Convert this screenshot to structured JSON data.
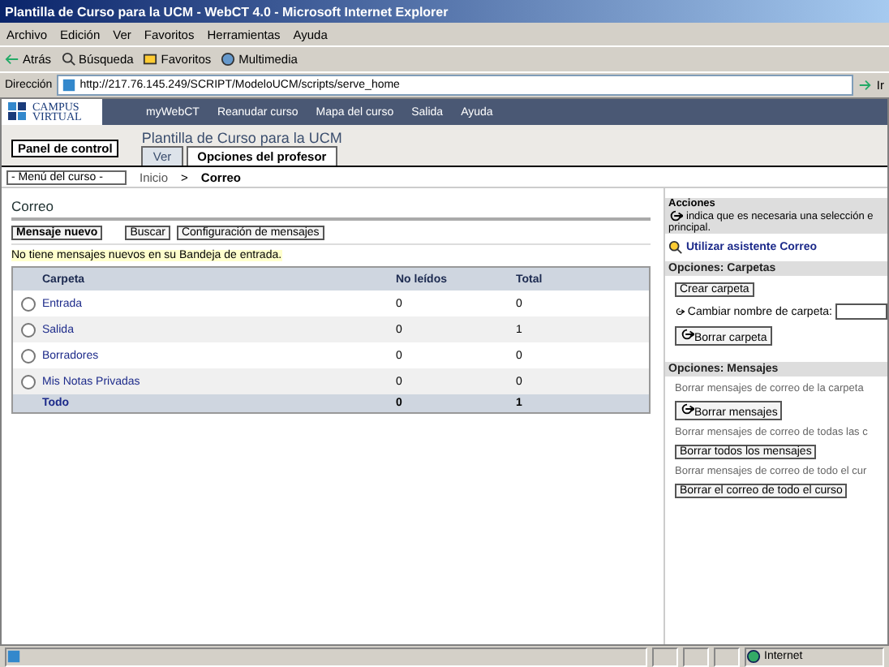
{
  "window": {
    "title": "Plantilla de Curso para la UCM - WebCT 4.0 - Microsoft Internet Explorer"
  },
  "menu": [
    "Archivo",
    "Edición",
    "Ver",
    "Favoritos",
    "Herramientas",
    "Ayuda"
  ],
  "toolbar": [
    {
      "kind": "back",
      "label": "Atrás"
    },
    {
      "kind": "search",
      "label": "Búsqueda"
    },
    {
      "kind": "favorites",
      "label": "Favoritos"
    },
    {
      "kind": "media",
      "label": "Multimedia"
    }
  ],
  "address": {
    "label": "Dirección",
    "url": "http://217.76.145.249/SCRIPT/ModeloUCM/scripts/serve_home",
    "go": "Ir"
  },
  "site": {
    "logo": [
      "CAMPUS",
      "VIRTUAL"
    ],
    "nav": [
      "myWebCT",
      "Reanudar curso",
      "Mapa del curso",
      "Salida",
      "Ayuda"
    ]
  },
  "course": {
    "control_panel": "Panel de control",
    "title": "Plantilla de Curso para la UCM",
    "tabs": [
      {
        "label": "Ver",
        "selected": false
      },
      {
        "label": "Opciones del profesor",
        "selected": true
      }
    ],
    "menu_select": "- Menú del curso -",
    "breadcrumb_separator": ">",
    "breadcrumb": [
      {
        "label": "Inicio",
        "current": false
      },
      {
        "label": "Correo",
        "current": true
      }
    ]
  },
  "mail": {
    "title": "Correo",
    "buttons": [
      "Mensaje nuevo",
      "Buscar",
      "Configuración de mensajes"
    ],
    "notice": "No tiene mensajes nuevos en su Bandeja de entrada.",
    "table": {
      "columns": [
        "Carpeta",
        "No leídos",
        "Total"
      ],
      "rows": [
        {
          "folder": "Entrada",
          "unread": "0",
          "total": "0",
          "selected": false
        },
        {
          "folder": "Salida",
          "unread": "0",
          "total": "1",
          "selected": false
        },
        {
          "folder": "Borradores",
          "unread": "0",
          "total": "0",
          "selected": false
        },
        {
          "folder": "Mis Notas Privadas",
          "unread": "0",
          "total": "0",
          "selected": false
        }
      ],
      "total": {
        "label": "Todo",
        "unread": "0",
        "total": "1"
      }
    }
  },
  "actions": {
    "title": "Acciones",
    "hint": "indica que es necesaria una selección e",
    "hint_2": "principal.",
    "wizard": "Utilizar asistente Correo",
    "folders": {
      "title": "Opciones: Carpetas",
      "create": "Crear carpeta",
      "rename": "Cambiar nombre de carpeta:",
      "delete": "Borrar carpeta"
    },
    "messages": {
      "title": "Opciones: Mensajes",
      "items": [
        {
          "text": "Borrar mensajes de correo de la carpeta",
          "button": "Borrar mensajes",
          "needs_selection": true
        },
        {
          "text": "Borrar mensajes de correo de todas las c",
          "button": "Borrar todos los mensajes",
          "needs_selection": false
        },
        {
          "text": "Borrar mensajes de correo de todo el cur",
          "button": "Borrar el correo de todo el curso",
          "needs_selection": false
        }
      ]
    }
  },
  "status_bar": {
    "zone": "Internet"
  }
}
